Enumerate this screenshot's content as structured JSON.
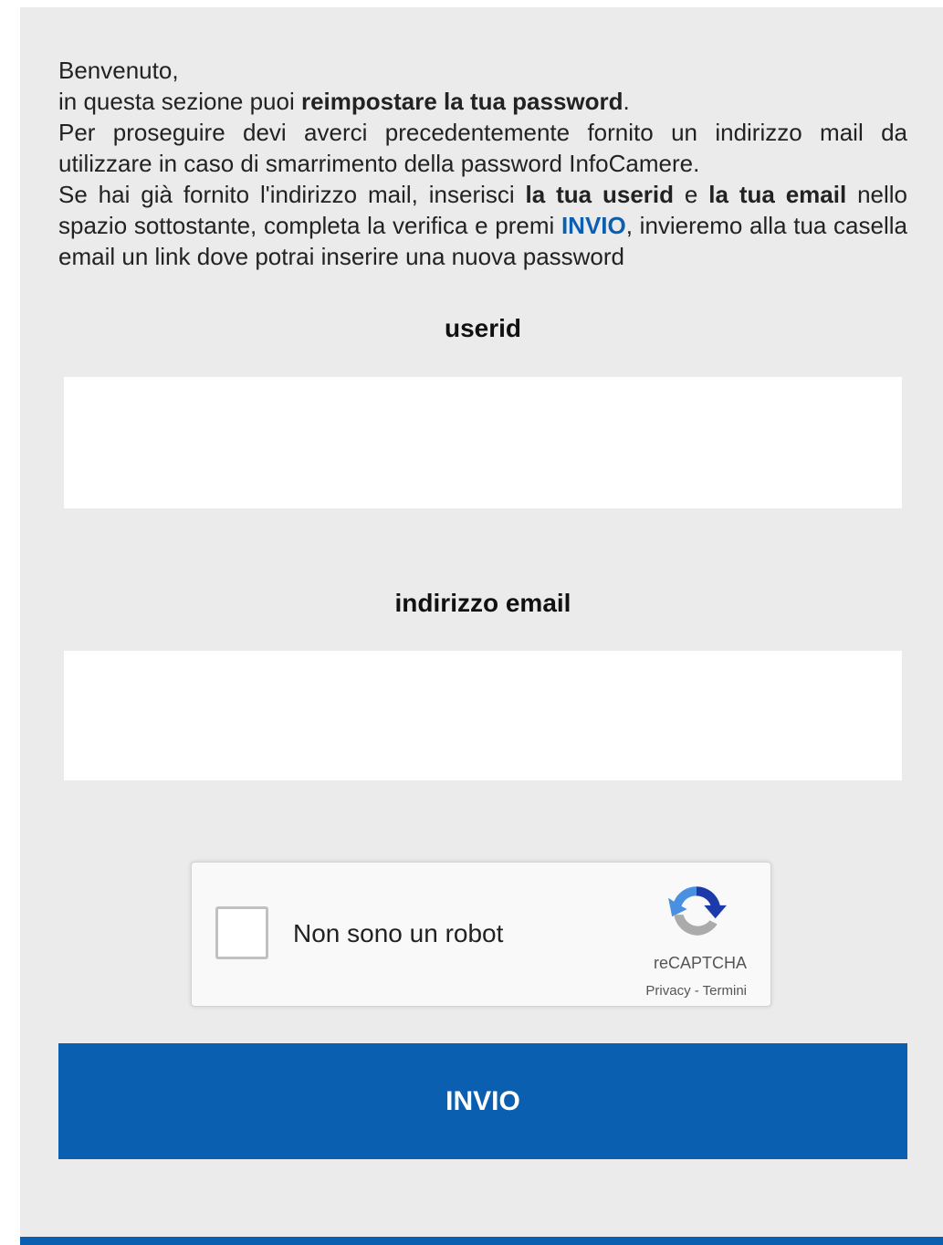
{
  "intro": {
    "greeting": "Benvenuto,",
    "line2_pre": "in questa sezione puoi ",
    "line2_bold": "reimpostare la tua password",
    "line2_post": ".",
    "para_requirement": "Per proseguire devi averci precedentemente fornito un indirizzo mail da utilizzare in caso di smarrimento della password InfoCamere.",
    "para3_a": "Se hai già fornito l'indirizzo mail, inserisci ",
    "para3_bold_userid": "la tua userid",
    "para3_b": " e ",
    "para3_bold_email": "la tua email",
    "para3_c": " nello spazio sottostante, completa la verifica e premi ",
    "para3_invio": "INVIO",
    "para3_d": ", invieremo alla tua casella email un link dove potrai inserire una nuova password"
  },
  "form": {
    "userid_label": "userid",
    "userid_value": "",
    "email_label": "indirizzo email",
    "email_value": ""
  },
  "captcha": {
    "label": "Non sono un robot",
    "brand": "reCAPTCHA",
    "privacy": "Privacy",
    "separator": " - ",
    "terms": "Termini",
    "checked": false
  },
  "submit": {
    "label": "INVIO"
  },
  "colors": {
    "accent": "#0a5fb0",
    "panel_bg": "#ebebeb"
  }
}
